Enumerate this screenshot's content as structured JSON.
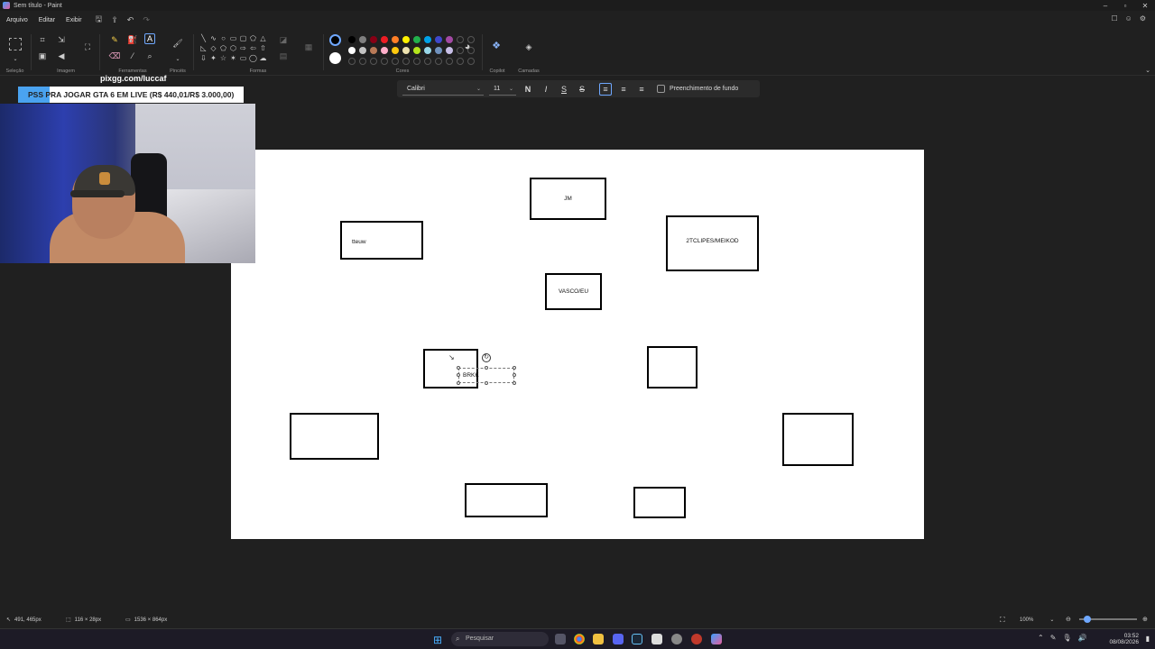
{
  "window": {
    "title": "Sem título - Paint"
  },
  "menu": {
    "items": [
      "Arquivo",
      "Editar",
      "Exibir"
    ]
  },
  "ribbon": {
    "groups": {
      "selecao": "Seleção",
      "imagem": "Imagem",
      "ferramentas": "Ferramentas",
      "pinceis": "Pincéis",
      "formas": "Formas",
      "cores": "Cores",
      "copilot": "Copilot",
      "camadas": "Camadas"
    },
    "colors_row1": [
      "#000000",
      "#7f7f7f",
      "#880015",
      "#ed1c24",
      "#ff7f27",
      "#fff200",
      "#22b14c",
      "#00a2e8",
      "#3f48cc",
      "#a349a4"
    ],
    "colors_row2": [
      "#ffffff",
      "#c3c3c3",
      "#b97a57",
      "#ffaec9",
      "#ffc90e",
      "#efe4b0",
      "#b5e61d",
      "#99d9ea",
      "#7092be",
      "#c8bfe7"
    ],
    "primary_color": "#000000",
    "secondary_color": "#ffffff"
  },
  "textbar": {
    "font": "Calibri",
    "size": "11",
    "bold": "N",
    "italic": "I",
    "underline": "S",
    "strike": "S",
    "fill_label": "Preenchimento de fundo"
  },
  "overlay": {
    "pix": "pixgg.com/luccaf",
    "banner": "PSS PRA JOGAR GTA 6 EM LIVE (R$ 440,01/R$ 3.000,00)"
  },
  "canvas": {
    "labels": {
      "jm": "JM",
      "tteuw": "tteuw",
      "tclipes": "2TCLIPES/MEIKOD",
      "vasco": "VASCO/EU",
      "brkk": "BRKK"
    }
  },
  "status": {
    "cursor": "491, 465px",
    "selection": "116 × 28px",
    "canvas_size": "1536 × 864px",
    "zoom": "100%"
  },
  "taskbar": {
    "search": "Pesquisar",
    "time": "03:52",
    "date": "08/08/2026"
  }
}
